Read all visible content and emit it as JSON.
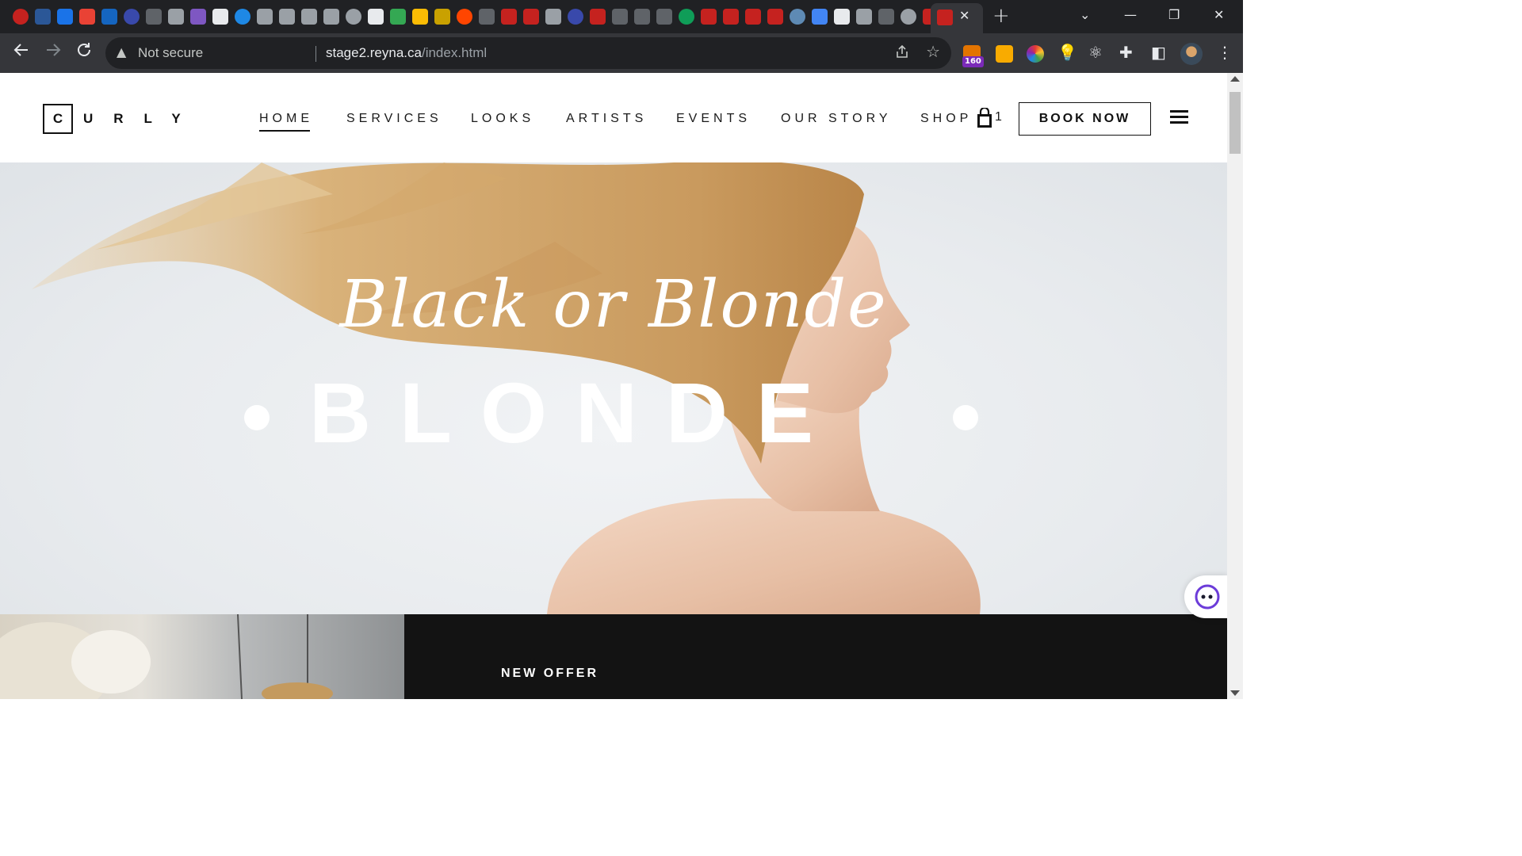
{
  "browser": {
    "tab_close_glyph": "✕",
    "new_tab_glyph": "+",
    "window_controls": {
      "dropdown": "⌄",
      "minimize": "—",
      "restore": "❐",
      "close": "✕"
    },
    "security_label": "Not secure",
    "url_host": "stage2.reyna.ca",
    "url_path": "/index.html",
    "extension_badge": "160"
  },
  "site": {
    "logo_first": "C",
    "logo_rest": "URLY",
    "nav": [
      {
        "label": "HOME",
        "active": true
      },
      {
        "label": "SERVICES"
      },
      {
        "label": "LOOKS"
      },
      {
        "label": "ARTISTS"
      },
      {
        "label": "EVENTS"
      },
      {
        "label": "OUR STORY"
      },
      {
        "label": "SHOP"
      }
    ],
    "cart_count": "1",
    "book_now": "BOOK NOW"
  },
  "hero": {
    "script_title": "Black or Blonde",
    "main_title": "BLONDE"
  },
  "offer": {
    "label": "NEW OFFER"
  },
  "colors": {
    "chrome_dark": "#202124",
    "toolbar": "#35363a",
    "offer_panel": "#131313",
    "hair_gold": "#d9b27a"
  }
}
